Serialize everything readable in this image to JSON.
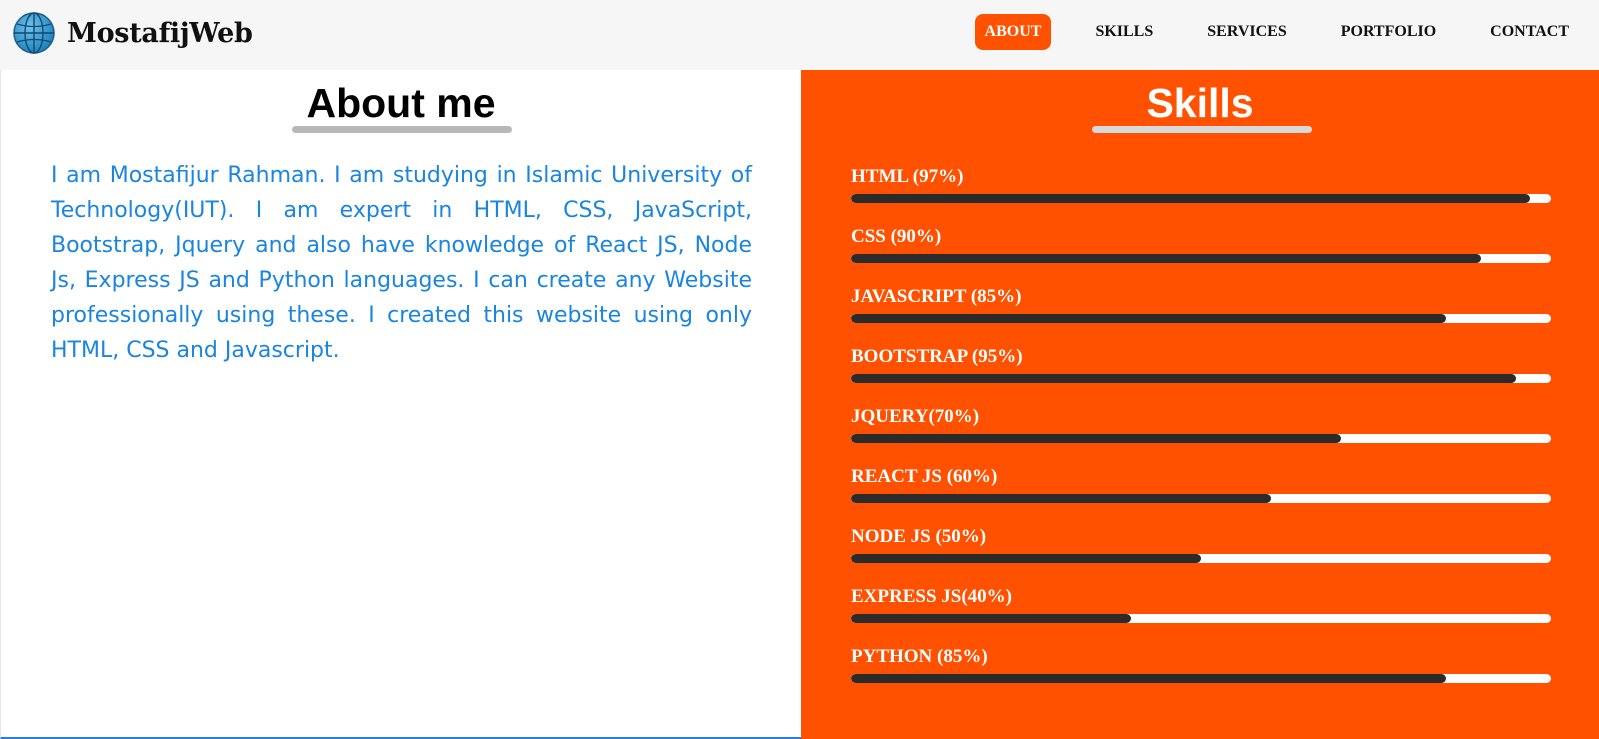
{
  "brand": {
    "name": "MostafijWeb",
    "icon": "globe-icon"
  },
  "nav": {
    "items": [
      {
        "label": "ABOUT",
        "active": true
      },
      {
        "label": "SKILLS",
        "active": false
      },
      {
        "label": "SERVICES",
        "active": false
      },
      {
        "label": "PORTFOLIO",
        "active": false
      },
      {
        "label": "CONTACT",
        "active": false
      }
    ]
  },
  "about": {
    "title": "About me",
    "text": "I am Mostafijur Rahman. I am studying in Islamic University of Technology(IUT). I am expert in HTML, CSS, JavaScript, Bootstrap, Jquery and also have knowledge of React JS, Node Js, Express JS and Python languages. I can create any Website professionally using these. I created this website using only HTML, CSS and Javascript."
  },
  "skills": {
    "title": "Skills",
    "items": [
      {
        "label": "HTML (97%)",
        "percent": 97
      },
      {
        "label": "CSS (90%)",
        "percent": 90
      },
      {
        "label": "JAVASCRIPT (85%)",
        "percent": 85
      },
      {
        "label": "BOOTSTRAP (95%)",
        "percent": 95
      },
      {
        "label": "JQUERY(70%)",
        "percent": 70
      },
      {
        "label": "REACT JS (60%)",
        "percent": 60
      },
      {
        "label": "NODE JS (50%)",
        "percent": 50
      },
      {
        "label": "EXPRESS JS(40%)",
        "percent": 40
      },
      {
        "label": "PYTHON (85%)",
        "percent": 85
      }
    ]
  },
  "colors": {
    "accent": "#ff5100",
    "bar_fill": "#2b2b2b",
    "bar_track": "#ffffff",
    "about_text": "#1a85e0"
  }
}
